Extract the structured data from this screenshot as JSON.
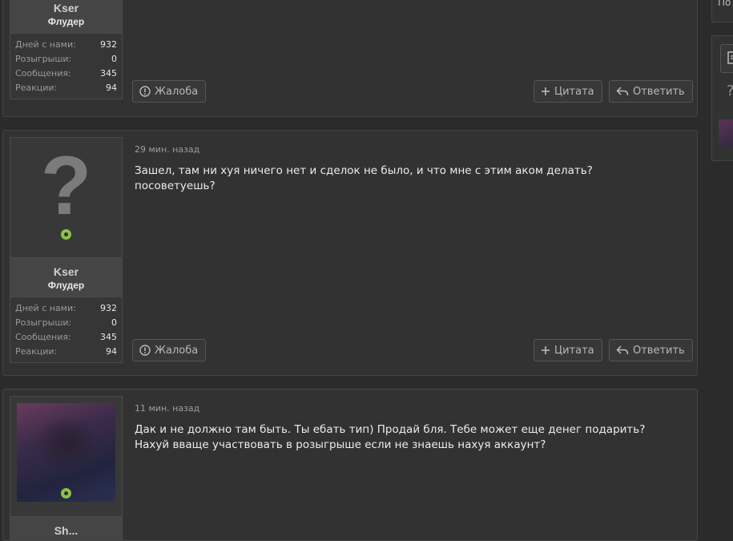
{
  "posts": [
    {
      "user": {
        "name": "Kser",
        "title": "Флудер"
      },
      "stats": [
        {
          "label": "Дней с нами:",
          "value": "932"
        },
        {
          "label": "Розыгрыши:",
          "value": "0"
        },
        {
          "label": "Сообщения:",
          "value": "345"
        },
        {
          "label": "Реакции:",
          "value": "94"
        }
      ],
      "actions": {
        "report": "Жалоба",
        "quote": "Цитата",
        "reply": "Ответить"
      }
    },
    {
      "time": "29 мин. назад",
      "text": "Зашел, там ни хуя ничего нет и сделок не было, и что мне с этим аком делать? посоветуешь?",
      "user": {
        "name": "Kser",
        "title": "Флудер"
      },
      "stats": [
        {
          "label": "Дней с нами:",
          "value": "932"
        },
        {
          "label": "Розыгрыши:",
          "value": "0"
        },
        {
          "label": "Сообщения:",
          "value": "345"
        },
        {
          "label": "Реакции:",
          "value": "94"
        }
      ],
      "actions": {
        "report": "Жалоба",
        "quote": "Цитата",
        "reply": "Ответить"
      }
    },
    {
      "time": "11 мин. назад",
      "text": "Дак и не должно там быть. Ты ебать тип) Продай бля. Тебе может еще денег подарить? Нахуй вваще участвовать в розыгрыше если не знаешь нахуя аккаунт?",
      "user": {
        "name": "Sh..."
      }
    }
  ],
  "sidebar": {
    "top_fragment": "По",
    "icon_fragment": "?"
  },
  "colors": {
    "online": "#8bc34a",
    "background": "#2b2b2b",
    "panel": "#323232"
  }
}
